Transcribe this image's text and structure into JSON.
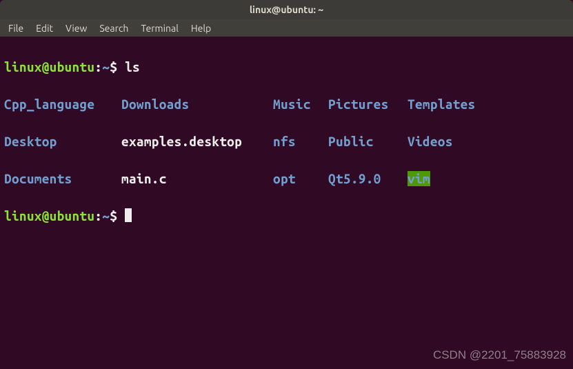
{
  "window": {
    "title": "linux@ubuntu: ~"
  },
  "menu": {
    "file": "File",
    "edit": "Edit",
    "view": "View",
    "search": "Search",
    "terminal": "Terminal",
    "help": "Help"
  },
  "prompt": {
    "userhost": "linux@ubuntu",
    "colon": ":",
    "path": "~",
    "sigil": "$"
  },
  "command": "ls",
  "ls": {
    "r1": {
      "c1": "Cpp_language",
      "c2": "Downloads",
      "c3": "Music",
      "c4": "Pictures",
      "c5": "Templates"
    },
    "r2": {
      "c1": "Desktop",
      "c2": "examples.desktop",
      "c3": "nfs",
      "c4": "Public",
      "c5": "Videos"
    },
    "r3": {
      "c1": "Documents",
      "c2": "main.c",
      "c3": "opt",
      "c4": "Qt5.9.0",
      "c5": "vim"
    }
  },
  "watermark": "CSDN @2201_75883928"
}
